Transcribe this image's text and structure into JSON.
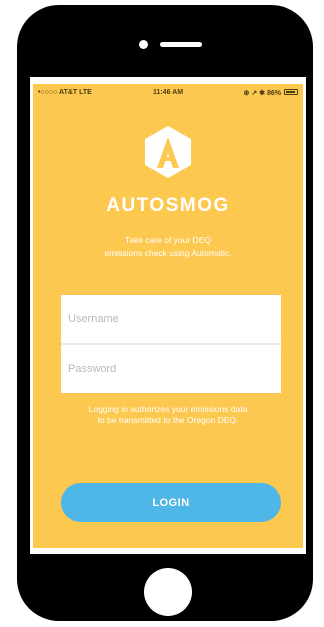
{
  "status_bar": {
    "carrier": "•○○○○ AT&T LTE",
    "time": "11:46 AM",
    "indicators": "⊕ ↗ ✱ 86%",
    "battery_level": 0.86
  },
  "app": {
    "logo_icon": "hexagon-a-logo",
    "brand": "AUTOSMOG",
    "tagline": [
      "Take care of your DEQ",
      "emissions check using Automatic."
    ],
    "username_placeholder": "Username",
    "password_placeholder": "Password",
    "disclaimer": [
      "Logging in authorizes your emissions data",
      "to be transmitted to the Oregon DEQ."
    ],
    "login_label": "LOGIN"
  },
  "colors": {
    "background": "#fcc84f",
    "button": "#4fb6e8",
    "phone_frame": "#000000"
  }
}
